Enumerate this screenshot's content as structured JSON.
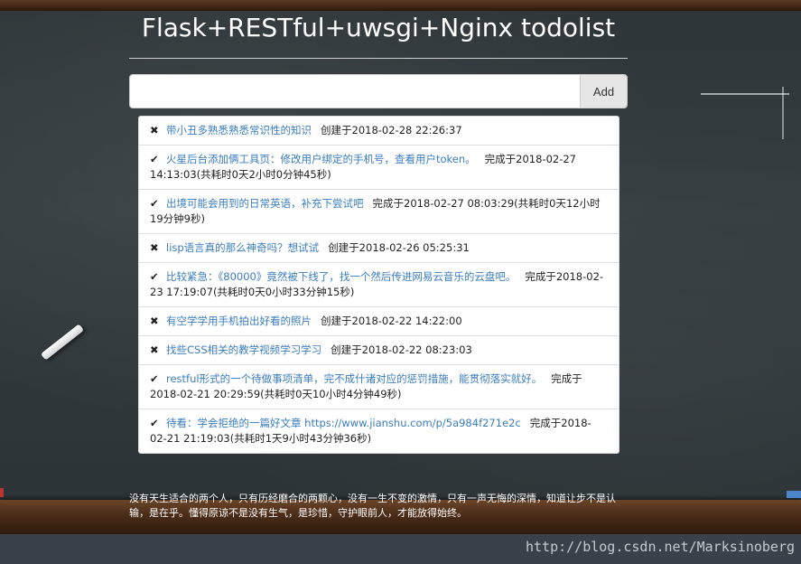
{
  "page": {
    "title": "Flask+RESTful+uwsgi+Nginx todolist"
  },
  "form": {
    "input_value": "",
    "input_placeholder": "",
    "add_label": "Add"
  },
  "icons": {
    "done": "check-icon",
    "pending": "times-icon"
  },
  "todos": [
    {
      "done": false,
      "mark": "✖",
      "text": "带小丑多熟悉熟悉常识性的知识",
      "status": "创建于2018-02-28 22:26:37"
    },
    {
      "done": true,
      "mark": "✔",
      "text": "火星后台添加俩工具页：修改用户绑定的手机号，查看用户token。",
      "status": "完成于2018-02-27 14:13:03(共耗时0天2小时0分钟45秒)"
    },
    {
      "done": true,
      "mark": "✔",
      "text": "出境可能会用到的日常英语，补充下尝试吧",
      "status": "完成于2018-02-27 08:03:29(共耗时0天12小时19分钟9秒)"
    },
    {
      "done": false,
      "mark": "✖",
      "text": "lisp语言真的那么神奇吗？想试试",
      "status": "创建于2018-02-26 05:25:31"
    },
    {
      "done": true,
      "mark": "✔",
      "text": "比较紧急：《80000》竟然被下线了，找一个然后传进网易云音乐的云盘吧。",
      "status": "完成于2018-02-23 17:19:07(共耗时0天0小时33分钟15秒)"
    },
    {
      "done": false,
      "mark": "✖",
      "text": "有空学学用手机拍出好看的照片",
      "status": "创建于2018-02-22 14:22:00"
    },
    {
      "done": false,
      "mark": "✖",
      "text": "找些CSS相关的教学视频学习学习",
      "status": "创建于2018-02-22 08:23:03"
    },
    {
      "done": true,
      "mark": "✔",
      "text": "restful形式的一个待做事项清单，完不成什诸对应的惩罚措施，能贯彻落实就好。",
      "status": "完成于2018-02-21 20:29:59(共耗时0天10小时4分钟49秒)"
    },
    {
      "done": true,
      "mark": "✔",
      "text": "待看：学会拒绝的一篇好文章 https://www.jianshu.com/p/5a984f271e2c",
      "status": "完成于2018-02-21 21:19:03(共耗时1天9小时43分钟36秒)"
    }
  ],
  "footer": {
    "quote": "没有天生适合的两个人，只有历经磨合的两颗心，没有一生不变的激情，只有一声无悔的深情，知道让步不是认输，是在乎。懂得原谅不是没有生气，是珍惜，守护眼前人，才能放得始终。"
  },
  "watermark": "http://blog.csdn.net/Marksinoberg"
}
